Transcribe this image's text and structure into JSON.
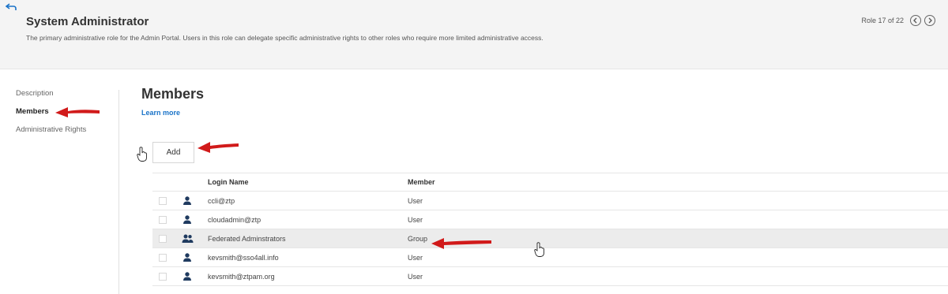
{
  "header": {
    "title": "System Administrator",
    "description": "The primary administrative role for the Admin Portal. Users in this role can delegate specific administrative rights to other roles who require more limited administrative access.",
    "counter": "Role 17 of 22"
  },
  "sidebar": {
    "items": [
      {
        "label": "Description"
      },
      {
        "label": "Members"
      },
      {
        "label": "Administrative Rights"
      }
    ]
  },
  "main": {
    "title": "Members",
    "learn_more": "Learn more",
    "add_label": "Add"
  },
  "table": {
    "headers": {
      "login": "Login Name",
      "member": "Member"
    },
    "rows": [
      {
        "login": "ccli@ztp",
        "member": "User",
        "icon": "user-icon"
      },
      {
        "login": "cloudadmin@ztp",
        "member": "User",
        "icon": "user-icon"
      },
      {
        "login": "Federated Adminstrators",
        "member": "Group",
        "icon": "group-icon"
      },
      {
        "login": "kevsmith@sso4all.info",
        "member": "User",
        "icon": "user-icon"
      },
      {
        "login": "kevsmith@ztpam.org",
        "member": "User",
        "icon": "user-icon"
      }
    ]
  },
  "colors": {
    "accent": "#1a73c8",
    "annotation_arrow": "#d11a1a",
    "icon": "#1f3a5f"
  }
}
